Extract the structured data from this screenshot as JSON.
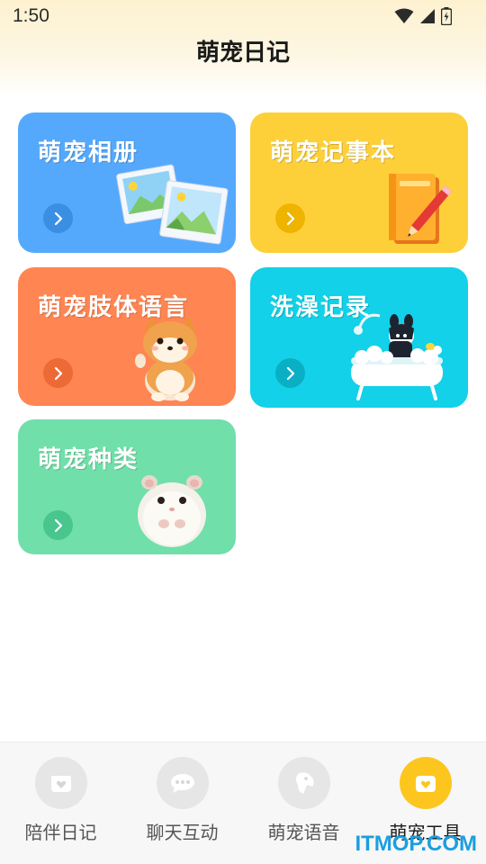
{
  "status_bar": {
    "time": "1:50"
  },
  "app_title": "萌宠日记",
  "colors": {
    "album": "#55a9fd",
    "notebook": "#fdd03a",
    "body_language": "#ff8552",
    "bath": "#12d1e8",
    "species": "#70dfa9",
    "nav_active": "#fdc61f"
  },
  "cards": [
    {
      "title": "萌宠相册",
      "icon": "photo-album-art"
    },
    {
      "title": "萌宠记事本",
      "icon": "notebook-pencil-art"
    },
    {
      "title": "萌宠肢体语言",
      "icon": "shiba-dog-art"
    },
    {
      "title": "洗澡记录",
      "icon": "dog-bathtub-art"
    },
    {
      "title": "萌宠种类",
      "icon": "hamster-art"
    }
  ],
  "bottom_nav": [
    {
      "label": "陪伴日记",
      "icon": "calendar-heart-icon",
      "active": false
    },
    {
      "label": "聊天互动",
      "icon": "chat-bubble-icon",
      "active": false
    },
    {
      "label": "萌宠语音",
      "icon": "dog-head-icon",
      "active": false
    },
    {
      "label": "萌宠工具",
      "icon": "calendar-heart-icon",
      "active": true
    }
  ],
  "watermark": "ITMOP.COM"
}
